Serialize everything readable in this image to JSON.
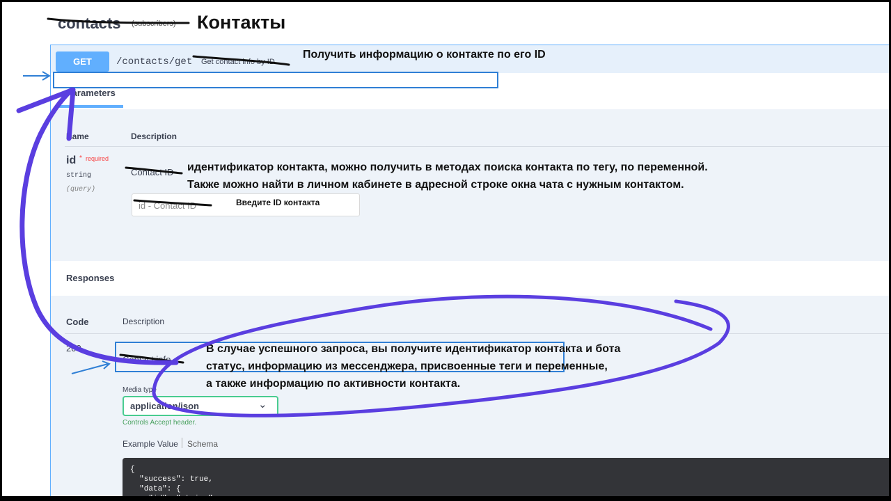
{
  "tag": {
    "name": "contacts",
    "subtitle": "(subscribers)",
    "annotation": "Контакты"
  },
  "operation": {
    "method": "GET",
    "path": "/contacts/get",
    "summary": "Get contact info by ID",
    "annotation": "Получить информацию о контакте по его ID"
  },
  "parameters": {
    "tab_label": "Parameters",
    "col_name": "Name",
    "col_description": "Description",
    "items": [
      {
        "name": "id",
        "required_star": "*",
        "required_label": "required",
        "type": "string",
        "in": "(query)",
        "description": "Contact ID",
        "annotation_line1": "идентификатор контакта, можно получить в методах поиска контакта по тегу, по переменной.",
        "annotation_line2": "Также можно найти в личном кабинете в адресной строке окна чата с нужным контактом.",
        "input_placeholder": "id - Contact ID",
        "input_annotation": "Введите ID контакта"
      }
    ]
  },
  "responses": {
    "title": "Responses",
    "col_code": "Code",
    "col_description": "Description",
    "items": [
      {
        "code": "200",
        "description": "Contact info",
        "annotation_line1": "В случае успешного запроса, вы получите идентификатор контакта и бота",
        "annotation_line2": "статус, информацию из мессенджера, присвоенные теги и переменные,",
        "annotation_line3": "а также информацию по активности контакта.",
        "media_type_label": "Media type",
        "media_type_value": "application/json",
        "controls_text": "Controls Accept header.",
        "example_tab": "Example Value",
        "schema_tab": "Schema",
        "example_code": "{\n  \"success\": true,\n  \"data\": {\n    \"id\": \"string\","
      }
    ]
  },
  "colors": {
    "get_method": "#61affe",
    "annotation_purple": "#5a3ee0",
    "highlight_blue": "#2f7fd5",
    "select_border": "#49cc90"
  }
}
